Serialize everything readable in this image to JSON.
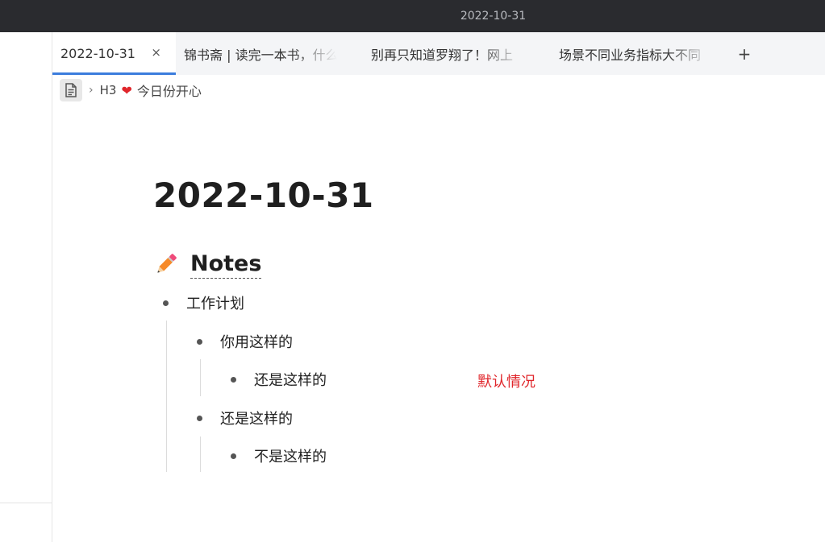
{
  "window": {
    "title": "2022-10-31"
  },
  "tabs": [
    {
      "label": "2022-10-31",
      "close": "×"
    },
    {
      "label": "锦书斋 | 读完一本书，什么"
    },
    {
      "label": "别再只知道罗翔了！网上"
    },
    {
      "label": "场景不同业务指标大不同"
    }
  ],
  "tabbar": {
    "add_label": "+"
  },
  "breadcrumb": {
    "sep": "›",
    "heading_level": "H3",
    "heart": "❤",
    "heading_text": "今日份开心"
  },
  "document": {
    "title": "2022-10-31",
    "section": {
      "icon": "pencil-icon",
      "heading": "Notes"
    },
    "items": [
      {
        "text": "工作计划",
        "level": 0
      },
      {
        "text": "你用这样的",
        "level": 1
      },
      {
        "text": "还是这样的",
        "level": 2
      },
      {
        "text": "还是这样的",
        "level": 1
      },
      {
        "text": "不是这样的",
        "level": 2
      }
    ],
    "annotation": "默认情况"
  },
  "colors": {
    "accent": "#3b7ddd",
    "annotation": "#e0262b",
    "titlebar": "#2a2b2f"
  }
}
